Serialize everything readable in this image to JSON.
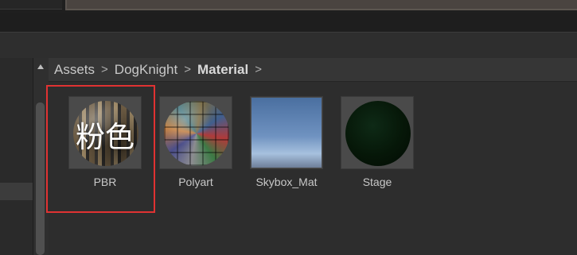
{
  "breadcrumb": {
    "items": [
      "Assets",
      "DogKnight",
      "Material"
    ],
    "separator": ">"
  },
  "assets": [
    {
      "label": "PBR",
      "overlay_text": "粉色",
      "icon": "pbr-material-sphere-icon"
    },
    {
      "label": "Polyart",
      "icon": "polyart-material-sphere-icon"
    },
    {
      "label": "Skybox_Mat",
      "icon": "skybox-material-icon"
    },
    {
      "label": "Stage",
      "icon": "stage-material-sphere-icon"
    }
  ],
  "colors": {
    "highlight": "#e03232",
    "background": "#282828",
    "breadcrumb_bar": "#363636"
  }
}
